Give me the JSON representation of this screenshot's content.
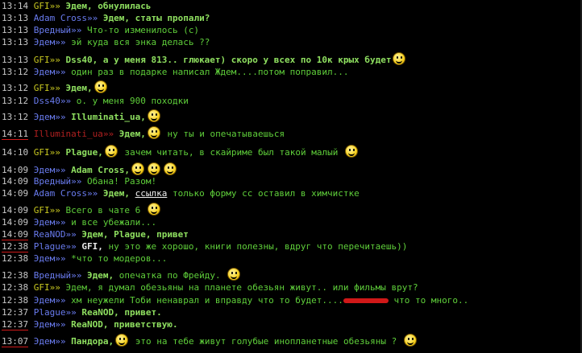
{
  "colors": {
    "gfi": "#c8c820",
    "adam": "#6a7cf0",
    "vredny": "#6a7cf0",
    "edem": "#6a7cf0",
    "dss40": "#6a7cf0",
    "illuminati": "#b02020",
    "plague": "#6a7cf0",
    "reanod": "#6a7cf0",
    "text": "#5fcf3a"
  },
  "messages": [
    {
      "time": "13:14",
      "nick": "GFI",
      "text": "Эдем, обнулилась"
    },
    {
      "time": "13:13",
      "nick": "Adam Cross",
      "text": "Эдем, статы пропали?"
    },
    {
      "time": "13:13",
      "nick": "Вредный",
      "text": "Что-то изменилось (с)"
    },
    {
      "time": "13:13",
      "nick": "Эдем",
      "text": "эй куда вся энка делась ??"
    },
    {
      "time": "13:13",
      "nick": "GFI",
      "text": "Dss40, а у меня 813.. глюкает) скоро у всех по 10к крых будет"
    },
    {
      "time": "13:12",
      "nick": "Эдем",
      "text": "один раз в подарке написал Ждем....потом поправил..."
    },
    {
      "time": "13:12",
      "nick": "GFI",
      "text": "Эдем,"
    },
    {
      "time": "13:12",
      "nick": "Dss40",
      "text": "о. у меня 900 походки"
    },
    {
      "time": "13:12",
      "nick": "Эдем",
      "text": "Illuminati_ua,"
    },
    {
      "time": "14:11",
      "nick": "Illuminati_ua",
      "text": "ну ты и опечатываешься",
      "pre": "Эдем,"
    },
    {
      "time": "14:10",
      "nick": "GFI",
      "text": "зачем читать, в скайриме был такой малый",
      "pre": "Plague,"
    },
    {
      "time": "14:09",
      "nick": "Эдем",
      "text": "Adam Cross,"
    },
    {
      "time": "14:09",
      "nick": "Вредный",
      "text": "Обана! Разом!"
    },
    {
      "time": "14:09",
      "nick": "Adam Cross",
      "pre": "Эдем,",
      "link": "ссылка",
      "text": "только форму сс оставил в химчистке"
    },
    {
      "time": "14:09",
      "nick": "GFI",
      "text": "Всего в чате 6"
    },
    {
      "time": "14:09",
      "nick": "Эдем",
      "text": "и все убежали..."
    },
    {
      "time": "14:09",
      "nick": "ReaNOD",
      "text": "Эдем, Plague, привет"
    },
    {
      "time": "12:38",
      "nick": "Plague",
      "pre": "GFI,",
      "text": "ну это же хорошо, книги полезны, вдруг что перечитаешь))"
    },
    {
      "time": "12:38",
      "nick": "Эдем",
      "text": "*что то модеров..."
    },
    {
      "time": "12:38",
      "nick": "Вредный",
      "pre": "Эдем,",
      "text": "опечатка по Фрейду."
    },
    {
      "time": "12:38",
      "nick": "GFI",
      "text": "Эдем, я думал обезьяны на планете обезьян живут.. или фильмы врут?"
    },
    {
      "time": "12:38",
      "nick": "Эдем",
      "text": "хм неужели Тоби ненаврал и вправду что то будет....",
      "tail": "что то много.."
    },
    {
      "time": "12:37",
      "nick": "Plague",
      "text": "ReaNOD, привет."
    },
    {
      "time": "12:37",
      "nick": "Эдем",
      "text": "ReaNOD, приветствую."
    },
    {
      "time": "13:07",
      "nick": "Эдем",
      "pre": "Пандора,",
      "text": "это на тебе живут голубые инопланетные обезьяны ?"
    }
  ],
  "sep": "»»"
}
